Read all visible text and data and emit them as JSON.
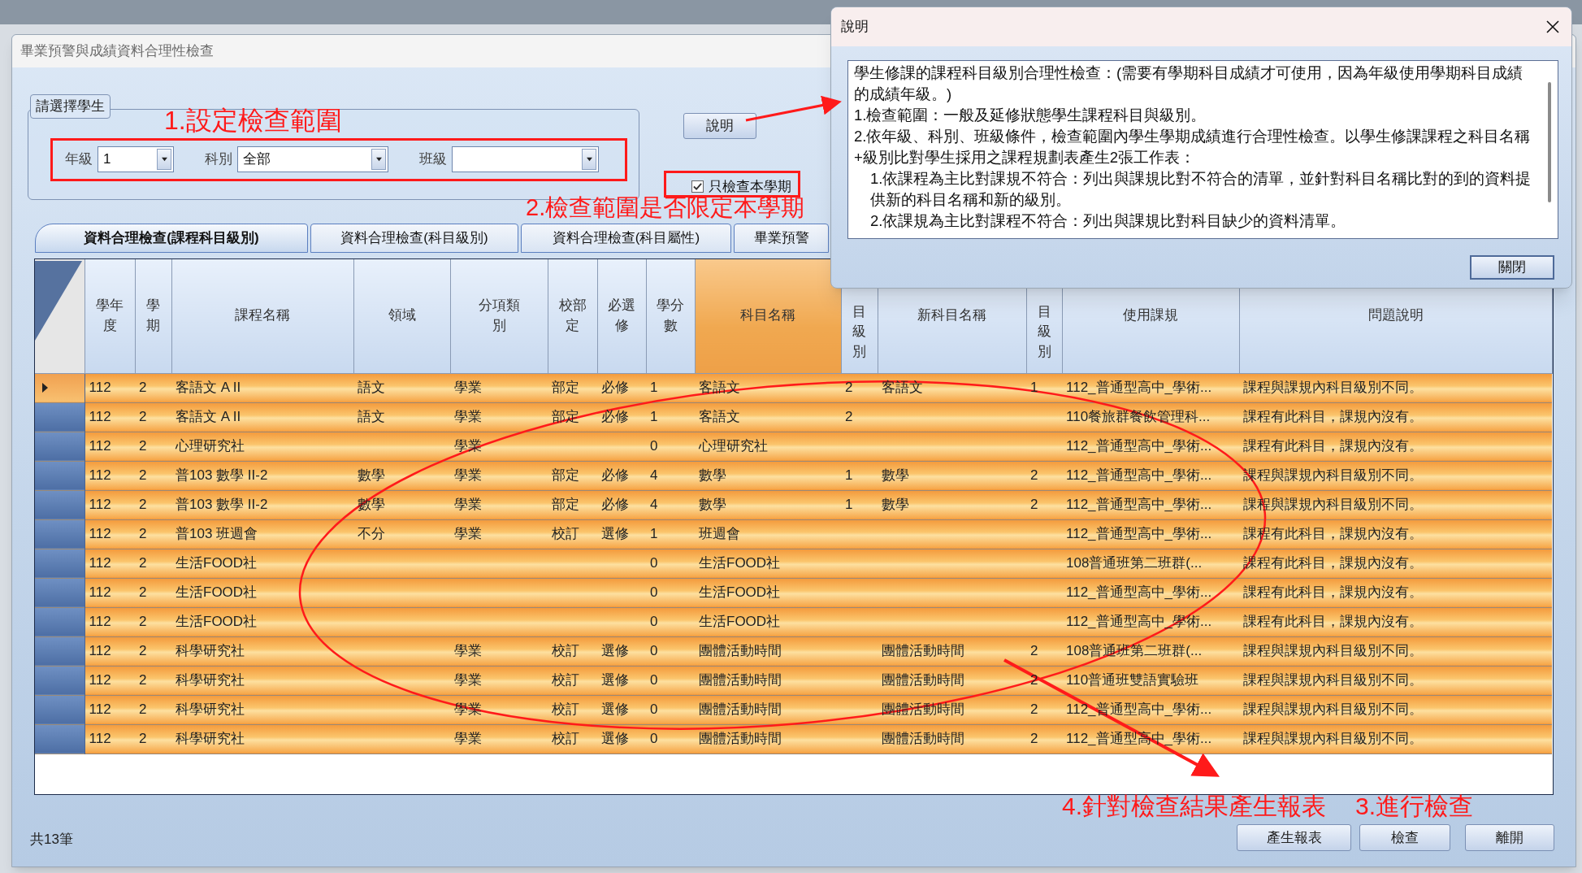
{
  "main_window": {
    "title": "畢業預警與成績資料合理性檢查"
  },
  "student_group": {
    "title": "請選擇學生",
    "filters": [
      {
        "label": "年級",
        "value": "1"
      },
      {
        "label": "科別",
        "value": "全部"
      },
      {
        "label": "班級"
      }
    ]
  },
  "help_button": "說明",
  "current_semester_only": {
    "label": "只檢查本學期",
    "checked": true
  },
  "tabs": [
    {
      "label": "資料合理檢查(課程科目級別)",
      "selected": true
    },
    {
      "label": "資料合理檢查(科目級別)",
      "selected": false
    },
    {
      "label": "資料合理檢查(科目屬性)",
      "selected": false
    },
    {
      "label": "畢業預警",
      "selected": false
    }
  ],
  "grid": {
    "columns": [
      {
        "label": "學年度",
        "highlighted": false
      },
      {
        "label": "學期",
        "highlighted": false
      },
      {
        "label": "課程名稱",
        "highlighted": false
      },
      {
        "label": "領域",
        "highlighted": false
      },
      {
        "label": "分項類別",
        "highlighted": false
      },
      {
        "label": "校部定",
        "highlighted": false
      },
      {
        "label": "必選修",
        "highlighted": false
      },
      {
        "label": "學分數",
        "highlighted": false
      },
      {
        "label": "科目名稱",
        "highlighted": true
      },
      {
        "label": "目級別",
        "highlighted": false
      },
      {
        "label": "新科目名稱",
        "highlighted": false
      },
      {
        "label": "目級別",
        "highlighted": false
      },
      {
        "label": "使用課規",
        "highlighted": false
      },
      {
        "label": "問題說明",
        "highlighted": false
      }
    ],
    "rows": [
      {
        "selected": true,
        "cells": [
          "112",
          "2",
          "客語文 A II",
          "語文",
          "學業",
          "部定",
          "必修",
          "1",
          "客語文",
          "2",
          "客語文",
          "1",
          "112_普通型高中_學術...",
          "課程與課規內科目級別不同。"
        ]
      },
      {
        "selected": false,
        "cells": [
          "112",
          "2",
          "客語文 A II",
          "語文",
          "學業",
          "部定",
          "必修",
          "1",
          "客語文",
          "2",
          null,
          null,
          "110餐旅群餐飲管理科...",
          "課程有此科目，課規內沒有。"
        ]
      },
      {
        "selected": false,
        "cells": [
          "112",
          "2",
          "心理研究社",
          null,
          "學業",
          null,
          null,
          "0",
          "心理研究社",
          null,
          null,
          null,
          "112_普通型高中_學術...",
          "課程有此科目，課規內沒有。"
        ]
      },
      {
        "selected": false,
        "cells": [
          "112",
          "2",
          "普103 數學 II-2",
          "數學",
          "學業",
          "部定",
          "必修",
          "4",
          "數學",
          "1",
          "數學",
          "2",
          "112_普通型高中_學術...",
          "課程與課規內科目級別不同。"
        ]
      },
      {
        "selected": false,
        "cells": [
          "112",
          "2",
          "普103 數學 II-2",
          "數學",
          "學業",
          "部定",
          "必修",
          "4",
          "數學",
          "1",
          "數學",
          "2",
          "112_普通型高中_學術...",
          "課程與課規內科目級別不同。"
        ]
      },
      {
        "selected": false,
        "cells": [
          "112",
          "2",
          "普103 班週會",
          "不分",
          "學業",
          "校訂",
          "選修",
          "1",
          "班週會",
          null,
          null,
          null,
          "112_普通型高中_學術...",
          "課程有此科目，課規內沒有。"
        ]
      },
      {
        "selected": false,
        "cells": [
          "112",
          "2",
          "生活FOOD社",
          null,
          null,
          null,
          null,
          "0",
          "生活FOOD社",
          null,
          null,
          null,
          "108普通班第二班群(...",
          "課程有此科目，課規內沒有。"
        ]
      },
      {
        "selected": false,
        "cells": [
          "112",
          "2",
          "生活FOOD社",
          null,
          null,
          null,
          null,
          "0",
          "生活FOOD社",
          null,
          null,
          null,
          "112_普通型高中_學術...",
          "課程有此科目，課規內沒有。"
        ]
      },
      {
        "selected": false,
        "cells": [
          "112",
          "2",
          "生活FOOD社",
          null,
          null,
          null,
          null,
          "0",
          "生活FOOD社",
          null,
          null,
          null,
          "112_普通型高中_學術...",
          "課程有此科目，課規內沒有。"
        ]
      },
      {
        "selected": false,
        "cells": [
          "112",
          "2",
          "科學研究社",
          null,
          "學業",
          "校訂",
          "選修",
          "0",
          "團體活動時間",
          null,
          "團體活動時間",
          "2",
          "108普通班第二班群(...",
          "課程與課規內科目級別不同。"
        ]
      },
      {
        "selected": false,
        "cells": [
          "112",
          "2",
          "科學研究社",
          null,
          "學業",
          "校訂",
          "選修",
          "0",
          "團體活動時間",
          null,
          "團體活動時間",
          "2",
          "110普通班雙語實驗班",
          "課程與課規內科目級別不同。"
        ]
      },
      {
        "selected": false,
        "cells": [
          "112",
          "2",
          "科學研究社",
          null,
          "學業",
          "校訂",
          "選修",
          "0",
          "團體活動時間",
          null,
          "團體活動時間",
          "2",
          "112_普通型高中_學術...",
          "課程與課規內科目級別不同。"
        ]
      },
      {
        "selected": false,
        "cells": [
          "112",
          "2",
          "科學研究社",
          null,
          "學業",
          "校訂",
          "選修",
          "0",
          "團體活動時間",
          null,
          "團體活動時間",
          "2",
          "112_普通型高中_學術...",
          "課程與課規內科目級別不同。"
        ]
      }
    ]
  },
  "record_count": "共13筆",
  "buttons": [
    "產生報表",
    "檢查",
    "離開"
  ],
  "help_dialog": {
    "title": "說明",
    "paragraphs": [
      {
        "text": "學生修課的課程科目級別合理性檢查：(需要有學期科目成績才可使用，因為年級使用學期科目成績的成績年級。)"
      },
      {
        "text": "1.檢查範圍：一般及延修狀態學生課程科目與級別。"
      },
      {
        "text": "2.依年級、科別、班級條件，檢查範圍內學生學期成績進行合理性檢查。以學生修課課程之科目名稱+級別比對學生採用之課程規劃表產生2張工作表：",
        "children": [
          {
            "text": "1.依課程為主比對課規不符合：列出與課規比對不符合的清單，並針對科目名稱比對的到的資料提供新的科目名稱和新的級別。"
          },
          {
            "text": "2.依課規為主比對課程不符合：列出與課規比對科目缺少的資料清單。"
          }
        ]
      }
    ],
    "close_button": "關閉"
  },
  "annotations": [
    {
      "text": "1.設定檢查範圍"
    },
    {
      "text": "2.檢查範圍是否限定本學期"
    },
    {
      "text": "4.針對檢查結果產生報表"
    },
    {
      "text": "3.進行檢查"
    }
  ]
}
